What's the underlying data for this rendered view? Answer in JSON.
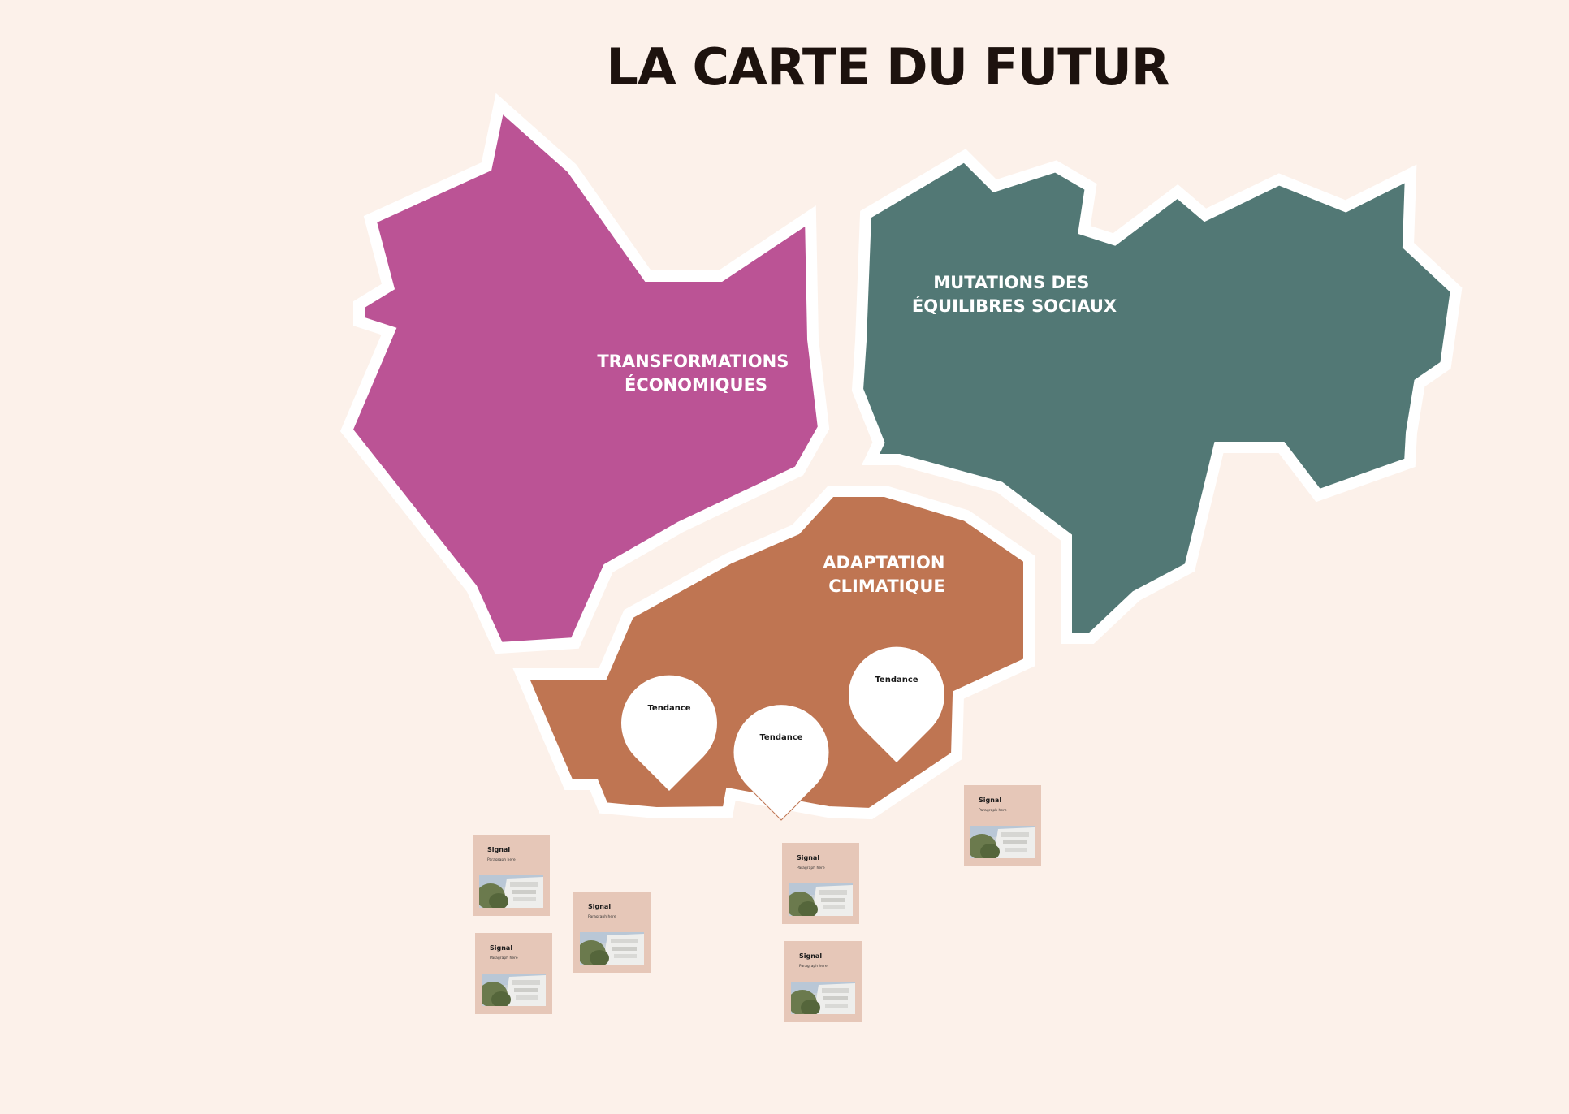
{
  "title": "LA CARTE DU FUTUR",
  "colors": {
    "background": "#fcf1ea",
    "economic": "#bb5395",
    "social": "#527875",
    "climate": "#bf7552",
    "signal_card": "#e6c7b8",
    "outline": "#ffffff"
  },
  "regions": {
    "economic": {
      "line1": "TRANSFORMATIONS",
      "line2": "ÉCONOMIQUES"
    },
    "social": {
      "line1": "MUTATIONS DES",
      "line2": "ÉQUILIBRES SOCIAUX"
    },
    "climate": {
      "line1": "ADAPTATION",
      "line2": "CLIMATIQUE"
    }
  },
  "pins": [
    {
      "label": "Tendance",
      "icon": "map-pin-icon"
    },
    {
      "label": "Tendance",
      "icon": "map-pin-icon"
    },
    {
      "label": "Tendance",
      "icon": "map-pin-icon"
    }
  ],
  "signals": [
    {
      "title": "Signal",
      "paragraph": "Paragraph here",
      "image": "building-photo"
    },
    {
      "title": "Signal",
      "paragraph": "Paragraph here",
      "image": "building-photo"
    },
    {
      "title": "Signal",
      "paragraph": "Paragraph here",
      "image": "building-photo"
    },
    {
      "title": "Signal",
      "paragraph": "Paragraph here",
      "image": "building-photo"
    },
    {
      "title": "Signal",
      "paragraph": "Paragraph here",
      "image": "building-photo"
    },
    {
      "title": "Signal",
      "paragraph": "Paragraph here",
      "image": "building-photo"
    }
  ]
}
